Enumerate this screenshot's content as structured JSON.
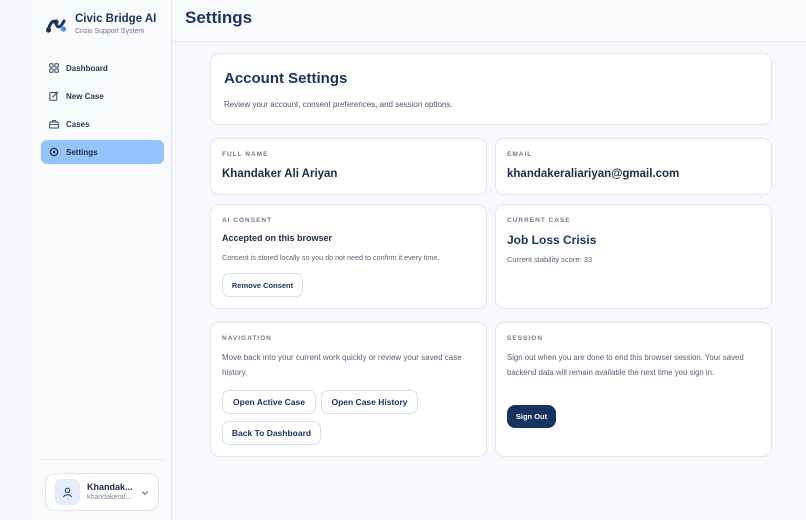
{
  "brand": {
    "name": "Civic Bridge AI",
    "subtitle": "Crisis Support System"
  },
  "sidebar": {
    "items": [
      {
        "label": "Dashboard",
        "icon": "dashboard-icon",
        "active": false
      },
      {
        "label": "New Case",
        "icon": "new-case-icon",
        "active": false
      },
      {
        "label": "Cases",
        "icon": "briefcase-icon",
        "active": false
      },
      {
        "label": "Settings",
        "icon": "settings-icon",
        "active": true
      }
    ],
    "user": {
      "name": "Khandak...",
      "email": "khandakeral..."
    }
  },
  "header": {
    "title": "Settings"
  },
  "account": {
    "title": "Account Settings",
    "subtitle": "Review your account, consent preferences, and session options."
  },
  "full_name": {
    "label": "FULL NAME",
    "value": "Khandaker Ali Ariyan"
  },
  "email": {
    "label": "EMAIL",
    "value": "khandakeraliariyan@gmail.com"
  },
  "ai_consent": {
    "label": "AI CONSENT",
    "status": "Accepted on this browser",
    "description": "Consent is stored locally so you do not need to confirm it every time.",
    "button": "Remove Consent"
  },
  "current_case": {
    "label": "CURRENT CASE",
    "title": "Job Loss Crisis",
    "score_text": "Current stability score: 33"
  },
  "navigation": {
    "label": "NAVIGATION",
    "description": "Move back into your current work quickly or review your saved case history.",
    "buttons": [
      "Open Active Case",
      "Open Case History",
      "Back To Dashboard"
    ]
  },
  "session": {
    "label": "SESSION",
    "description": "Sign out when you are done to end this browser session. Your saved backend data will remain available the next time you sign in.",
    "button": "Sign Out"
  },
  "colors": {
    "accent": "#93c5fd",
    "primary": "#16325f",
    "title": "#1c3461"
  }
}
